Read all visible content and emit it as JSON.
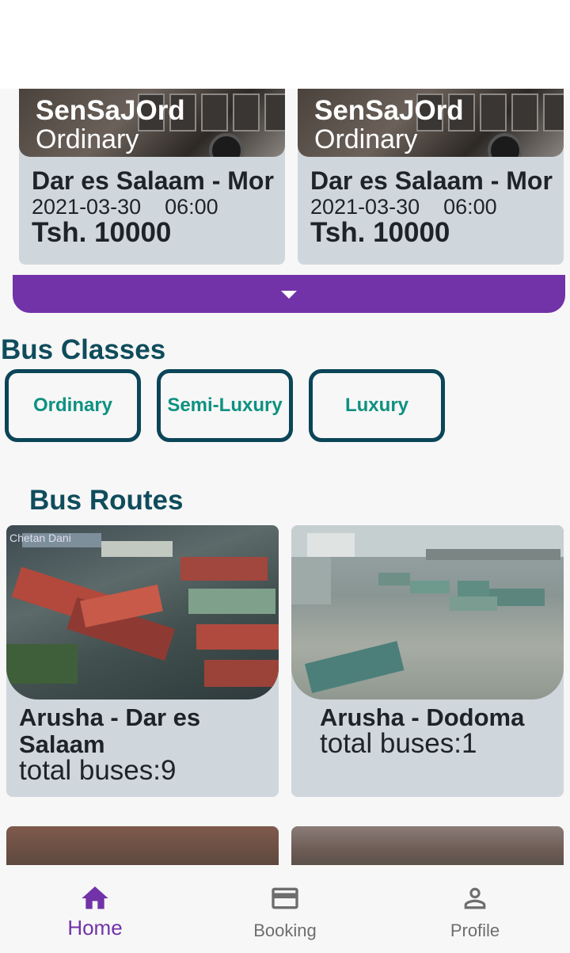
{
  "trips": [
    {
      "company": "SenSaJOrd",
      "class": "Ordinary",
      "route": "Dar es Salaam - Mor",
      "date": "2021-03-30",
      "time": "06:00",
      "price": "Tsh. 10000"
    },
    {
      "company": "SenSaJOrd",
      "class": "Ordinary",
      "route": "Dar es Salaam - Mor",
      "date": "2021-03-30",
      "time": "06:00",
      "price": "Tsh. 10000"
    }
  ],
  "bus_classes": {
    "title": "Bus Classes",
    "items": [
      "Ordinary",
      "Semi-Luxury",
      "Luxury"
    ]
  },
  "bus_routes": {
    "title": "Bus Routes",
    "items": [
      {
        "name": "Arusha - Dar es Salaam",
        "count": "total buses:9",
        "watermark": "Chetan Dani"
      },
      {
        "name": "Arusha - Dodoma",
        "count": "total buses:1"
      }
    ]
  },
  "nav": {
    "home": "Home",
    "booking": "Booking",
    "profile": "Profile"
  },
  "colors": {
    "accent": "#7232a8",
    "teal_border": "#0b4558",
    "teal_text": "#0e9180",
    "card_bg": "#d0d7dc"
  }
}
